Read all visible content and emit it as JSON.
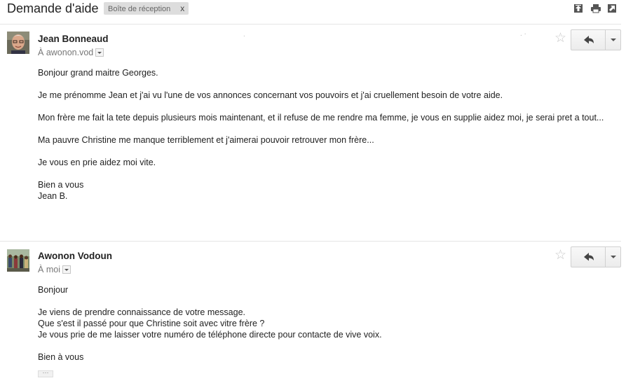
{
  "thread": {
    "subject": "Demande d'aide",
    "label": "Boîte de réception",
    "label_remove": "x",
    "toolbar_icons": [
      "open-new-window-icon",
      "print-icon",
      "expand-icon"
    ]
  },
  "messages": [
    {
      "sender": "Jean Bonneaud",
      "recipient_prefix": "À",
      "recipient": "awonon.vod",
      "star": "☆",
      "body": [
        "Bonjour grand maitre Georges.",
        "Je me prénomme Jean et j'ai vu l'une de vos annonces concernant vos pouvoirs et j'ai cruellement besoin de votre aide.",
        "Mon frère me fait la tete depuis plusieurs mois maintenant, et il refuse de me rendre ma femme, je vous en supplie aidez moi, je serai pret a tout...",
        "Ma pauvre Christine me manque terriblement et j'aimerai pouvoir retrouver mon frère...",
        "Je vous en prie aidez moi vite.",
        "Bien a vous",
        "Jean B."
      ]
    },
    {
      "sender": "Awonon Vodoun",
      "recipient_prefix": "À",
      "recipient": "moi",
      "star": "☆",
      "body": [
        "Bonjour",
        "Je viens de prendre connaissance de votre message.",
        "Que s'est il passé pour que Christine soit avec vitre frère ?",
        "Je vous prie de me laisser votre numéro de téléphone directe pour contacte de vive voix.",
        "Bien à vous"
      ],
      "trimmed_content": "···"
    }
  ]
}
